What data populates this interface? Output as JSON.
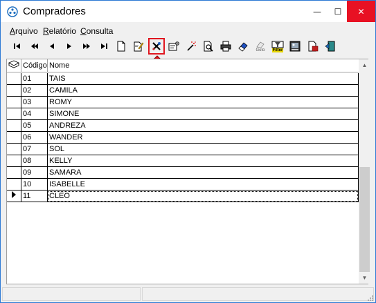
{
  "window": {
    "title": "Compradores",
    "minimize_glyph": "—",
    "maximize_glyph": "☐",
    "close_glyph": "✕",
    "close_color": "#e81123",
    "border_color": "#2b79d4"
  },
  "menu": {
    "items": [
      {
        "label": "Arquivo"
      },
      {
        "label": "Relatório"
      },
      {
        "label": "Consulta"
      }
    ]
  },
  "toolbar": {
    "buttons": [
      {
        "icon": "first-record-icon"
      },
      {
        "icon": "prior-page-icon"
      },
      {
        "icon": "prior-record-icon"
      },
      {
        "icon": "next-record-icon"
      },
      {
        "icon": "next-page-icon"
      },
      {
        "icon": "last-record-icon"
      },
      {
        "icon": "new-document-icon"
      },
      {
        "icon": "edit-document-icon"
      },
      {
        "icon": "delete-tools-icon",
        "highlighted": true
      },
      {
        "icon": "properties-icon"
      },
      {
        "icon": "magic-wand-icon"
      },
      {
        "icon": "print-preview-icon"
      },
      {
        "icon": "printer-icon"
      },
      {
        "icon": "eraser-icon"
      },
      {
        "icon": "goto-icon",
        "label": "Goto"
      },
      {
        "icon": "filter-icon",
        "label": "Filter"
      },
      {
        "icon": "picture-icon"
      },
      {
        "icon": "export-icon"
      },
      {
        "icon": "exit-door-icon"
      }
    ],
    "highlight_color": "#e0161f"
  },
  "grid": {
    "columns": [
      {
        "label": "Código"
      },
      {
        "label": "Nome"
      }
    ],
    "rows": [
      {
        "code": "01",
        "name": "TAIS"
      },
      {
        "code": "02",
        "name": "CAMILA"
      },
      {
        "code": "03",
        "name": "ROMY"
      },
      {
        "code": "04",
        "name": "SIMONE"
      },
      {
        "code": "05",
        "name": "ANDREZA"
      },
      {
        "code": "06",
        "name": "WANDER"
      },
      {
        "code": "07",
        "name": "SOL"
      },
      {
        "code": "08",
        "name": "KELLY"
      },
      {
        "code": "09",
        "name": "SAMARA"
      },
      {
        "code": "10",
        "name": "ISABELLE"
      },
      {
        "code": "11",
        "name": "CLEO",
        "current": true
      }
    ],
    "scroll_up_glyph": "▲",
    "scroll_down_glyph": "▼"
  }
}
